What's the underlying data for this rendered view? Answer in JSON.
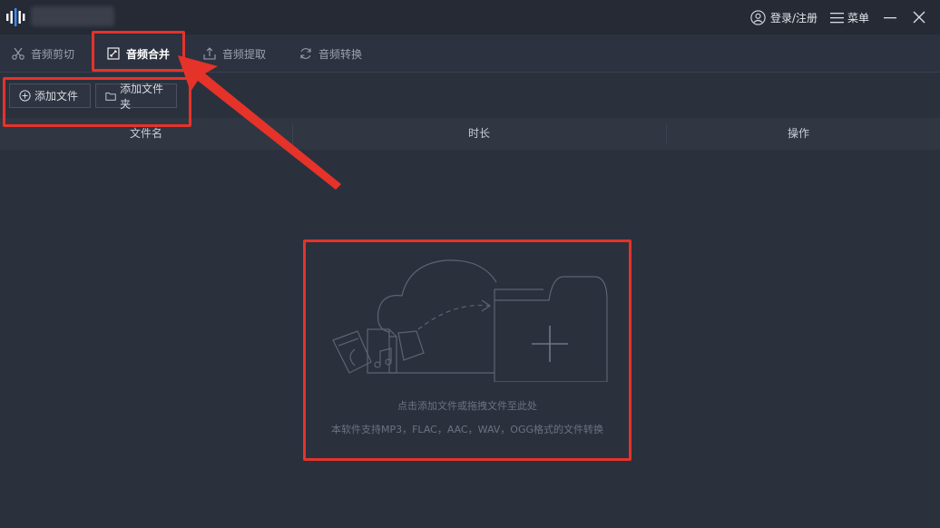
{
  "titlebar": {
    "login_label": "登录/注册",
    "menu_label": "菜单",
    "logo_icon": "waveform-logo-icon",
    "accent_color": "#3f8cff"
  },
  "tabs": [
    {
      "label": "音频剪切",
      "icon": "scissors-icon",
      "active": false
    },
    {
      "label": "音频合并",
      "icon": "merge-icon",
      "active": true
    },
    {
      "label": "音频提取",
      "icon": "upload-icon",
      "active": false
    },
    {
      "label": "音频转换",
      "icon": "refresh-icon",
      "active": false
    }
  ],
  "toolbar": {
    "add_file_label": "添加文件",
    "add_folder_label": "添加文件夹"
  },
  "table": {
    "columns": [
      "文件名",
      "时长",
      "操作"
    ]
  },
  "dropzone": {
    "hint": "点击添加文件或拖拽文件至此处",
    "formats": "本软件支持MP3，FLAC，AAC，WAV，OGG格式的文件转换"
  },
  "colors": {
    "background": "#2b303d",
    "annotation_red": "#e5332a"
  }
}
